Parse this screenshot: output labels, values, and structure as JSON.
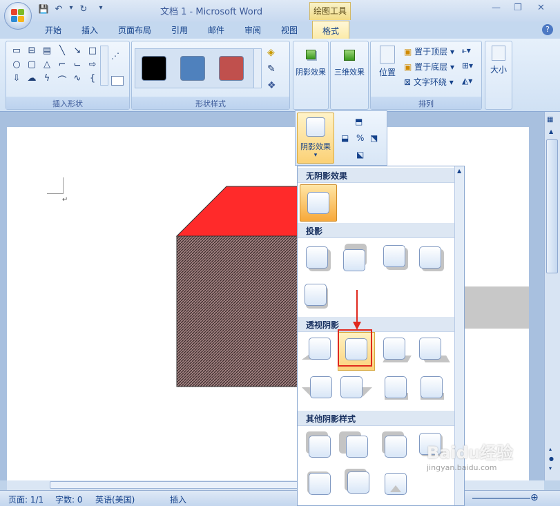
{
  "window": {
    "title": "文档 1 - Microsoft Word",
    "tools_context": "绘图工具"
  },
  "qat": {
    "save": "💾",
    "undo": "↶",
    "undo_arrow": "▾",
    "redo": "↻",
    "customize": "▾"
  },
  "window_controls": {
    "minimize": "—",
    "restore": "❐",
    "close": "✕"
  },
  "tabs": [
    "开始",
    "插入",
    "页面布局",
    "引用",
    "邮件",
    "审阅",
    "视图"
  ],
  "active_tab": "格式",
  "help": "?",
  "ribbon": {
    "insert_shapes": {
      "label": "插入形状"
    },
    "shape_styles": {
      "label": "形状样式",
      "swatch_colors": [
        "#000000",
        "#4f81bd",
        "#c0504d"
      ]
    },
    "shadow_effects": {
      "label": "阴影效果"
    },
    "effects_3d": {
      "label": "三维效果"
    },
    "arrange": {
      "label": "排列",
      "position": "位置",
      "bring_front": "置于顶层",
      "send_back": "置于底层",
      "text_wrap": "文字环绕"
    },
    "size": {
      "label": "大小"
    }
  },
  "gallery": {
    "sections": {
      "no_shadow": "无阴影效果",
      "drop_shadow": "投影",
      "perspective": "透视阴影",
      "other": "其他阴影样式"
    }
  },
  "popout": {
    "label": "阴影效果",
    "arrow": "▾"
  },
  "status": {
    "page": "页面: 1/1",
    "words": "字数: 0",
    "language": "英语(美国)",
    "mode": "插入"
  },
  "doc": {
    "paragraph_mark": "↵"
  },
  "shape": {
    "top_color": "#ff2a2a",
    "front_color": "#7a6a6a",
    "shadow_color": "#c8c8c8"
  },
  "highlight_color": "#e0291e",
  "watermark": {
    "brand": "Baidu经验",
    "sub": "jingyan.baidu.com"
  }
}
